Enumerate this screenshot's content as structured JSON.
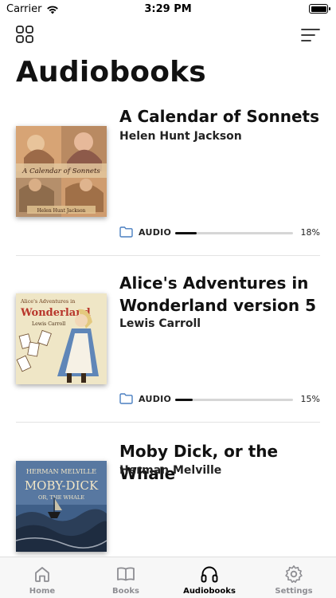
{
  "status_bar": {
    "carrier": "Carrier",
    "time": "3:29 PM"
  },
  "page": {
    "title": "Audiobooks"
  },
  "books": [
    {
      "title": "A Calendar of Sonnets",
      "author": "Helen Hunt Jackson",
      "format": "AUDIO",
      "progress": 0.18,
      "progress_text": "18%",
      "cover_title": "A Calendar of Sonnets",
      "cover_author": "Helen Hunt Jackson"
    },
    {
      "title": "Alice's Adventures in Wonderland version 5",
      "author": "Lewis Carroll",
      "format": "AUDIO",
      "progress": 0.15,
      "progress_text": "15%",
      "cover_title_line1": "Alice's Adventures in",
      "cover_title_line2": "Wonderland",
      "cover_author": "Lewis Carroll"
    },
    {
      "title": "Moby Dick, or the Whale",
      "author": "Herman Melville",
      "cover_author": "HERMAN MELVILLE",
      "cover_title": "MOBY-DICK",
      "cover_subtitle": "OR, THE WHALE"
    }
  ],
  "tab_bar": {
    "tabs": [
      {
        "label": "Home",
        "icon": "home-icon",
        "active": false
      },
      {
        "label": "Books",
        "icon": "book-icon",
        "active": false
      },
      {
        "label": "Audiobooks",
        "icon": "headphones-icon",
        "active": true
      },
      {
        "label": "Settings",
        "icon": "gear-icon",
        "active": false
      }
    ]
  },
  "colors": {
    "accent": "#000000",
    "inactive": "#8e8e93",
    "folder": "#4a7fc1",
    "progress": "#111111",
    "track": "#d6d6d6"
  }
}
